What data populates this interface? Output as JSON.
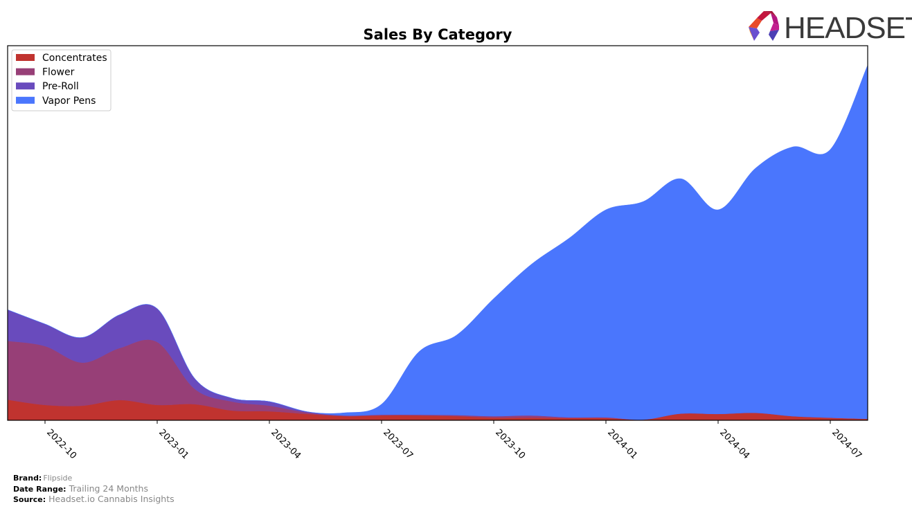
{
  "chart_data": {
    "type": "area",
    "stacked": true,
    "title": "Sales By Category",
    "xlabel": "",
    "ylabel": "",
    "y_axis_shown": false,
    "ylim": [
      0,
      100
    ],
    "y_units": "relative sales (axis top = 100)",
    "x": [
      "2022-09",
      "2022-10",
      "2022-11",
      "2022-12",
      "2023-01",
      "2023-02",
      "2023-03",
      "2023-04",
      "2023-05",
      "2023-06",
      "2023-07",
      "2023-08",
      "2023-09",
      "2023-10",
      "2023-11",
      "2023-12",
      "2024-01",
      "2024-02",
      "2024-03",
      "2024-04",
      "2024-05",
      "2024-06",
      "2024-07",
      "2024-08"
    ],
    "x_ticks": [
      "2022-10",
      "2023-01",
      "2023-04",
      "2023-07",
      "2023-10",
      "2024-01",
      "2024-04",
      "2024-07"
    ],
    "series": [
      {
        "name": "Concentrates",
        "color": "#c0332f",
        "values": [
          5.5,
          4.1,
          3.9,
          5.4,
          4.1,
          4.3,
          2.6,
          2.4,
          1.7,
          1.1,
          1.3,
          1.3,
          1.1,
          0.7,
          0.7,
          0.6,
          0.6,
          0.2,
          1.8,
          1.7,
          2.0,
          1.1,
          0.7,
          0.4
        ]
      },
      {
        "name": "Flower",
        "color": "#973f77",
        "values": [
          15.7,
          15.7,
          11.5,
          13.9,
          16.8,
          4.1,
          2.4,
          1.5,
          0.4,
          0.2,
          0.2,
          0.2,
          0.3,
          0.4,
          0.6,
          0.2,
          0.2,
          0,
          0,
          0,
          0,
          0,
          0,
          0
        ]
      },
      {
        "name": "Pre-Roll",
        "color": "#694bbd",
        "values": [
          8.3,
          5.9,
          6.7,
          8.9,
          8.9,
          2.8,
          0.9,
          1.1,
          0.2,
          0,
          0,
          0,
          0,
          0,
          0,
          0,
          0,
          0,
          0,
          0,
          0,
          0,
          0,
          0
        ]
      },
      {
        "name": "Vapor Pens",
        "color": "#4a76fd",
        "values": [
          0,
          0,
          0,
          0,
          0,
          0,
          0,
          0,
          0,
          0.7,
          2.8,
          16.8,
          21.3,
          31.4,
          40.3,
          47.7,
          55.4,
          58.2,
          62.7,
          54.5,
          65.3,
          71.9,
          71.6,
          94.4
        ]
      }
    ],
    "legend": {
      "placement": "top-left",
      "entries": [
        "Concentrates",
        "Flower",
        "Pre-Roll",
        "Vapor Pens"
      ]
    },
    "grid": false
  },
  "logo": {
    "text": "HEADSET"
  },
  "footer": {
    "brand_label": "Brand:",
    "brand_value": "Flipside",
    "date_range_label": "Date Range:",
    "date_range_value": "Trailing 24 Months",
    "source_label": "Source:",
    "source_value": "Headset.io Cannabis Insights"
  }
}
